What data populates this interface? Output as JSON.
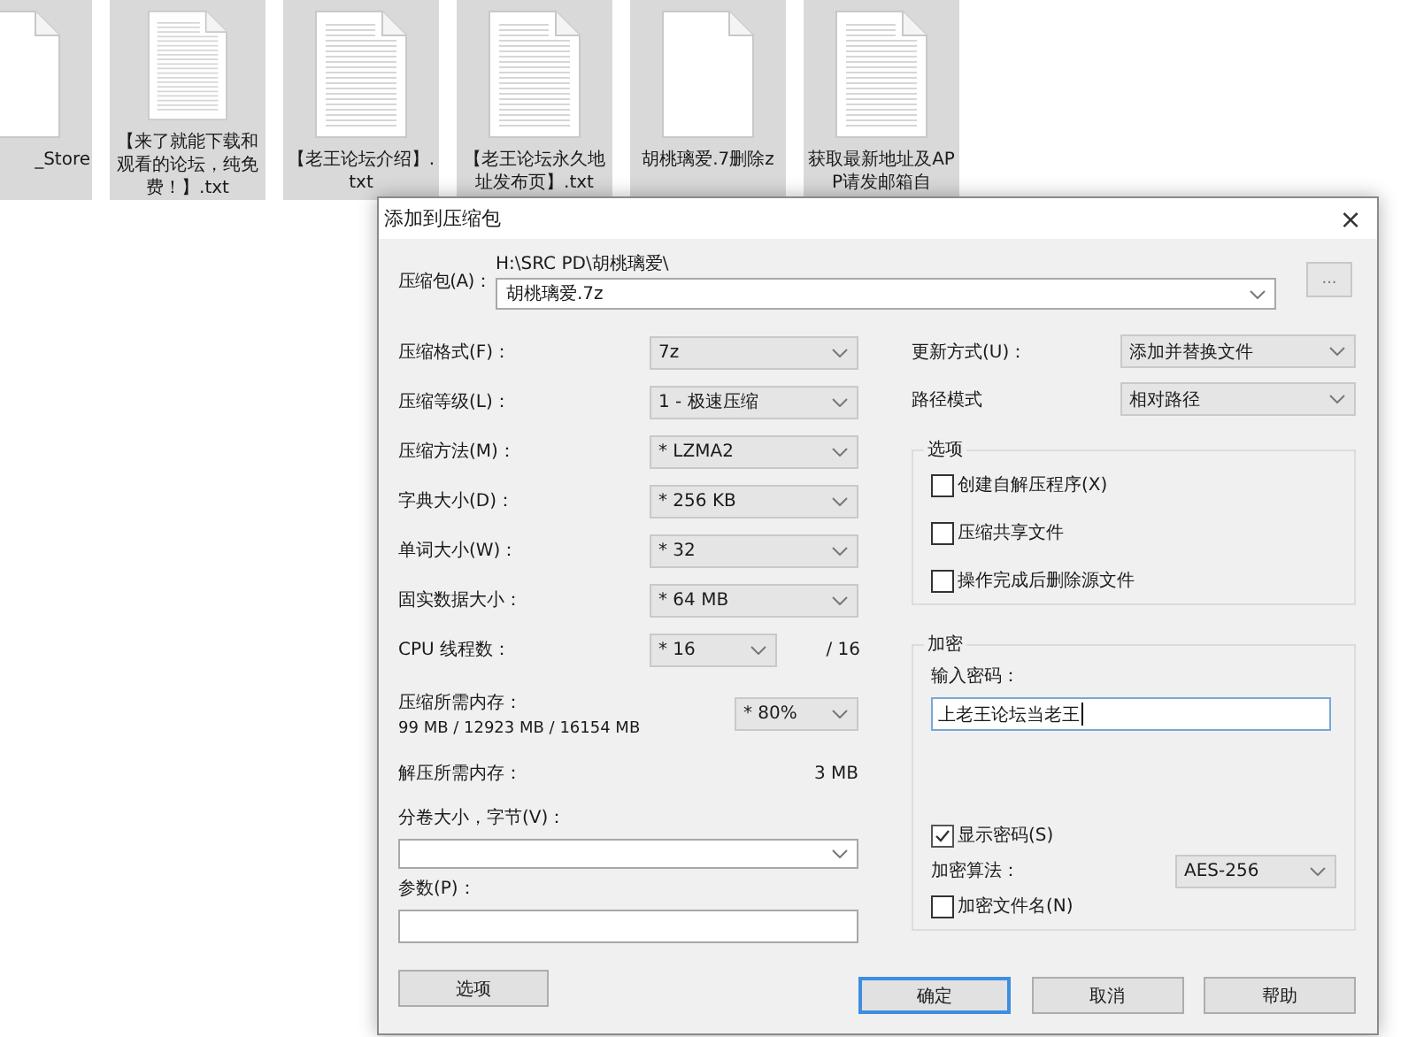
{
  "desktop": {
    "files": [
      {
        "name": "_Store",
        "kind": "blank"
      },
      {
        "name": "【来了就能下载和观看的论坛，纯免费！】.txt",
        "kind": "text"
      },
      {
        "name": "【老王论坛介绍】.txt",
        "kind": "text"
      },
      {
        "name": "【老王论坛永久地址发布页】.txt",
        "kind": "text"
      },
      {
        "name": "胡桃璃爱.7删除z",
        "kind": "blank"
      },
      {
        "name": "获取最新地址及APP请发邮箱自",
        "kind": "text"
      }
    ]
  },
  "dialog": {
    "title": "添加到压缩包",
    "close": "×",
    "archive": {
      "label": "压缩包(A)：",
      "path": "H:\\SRC PD\\胡桃璃爱\\",
      "value": "胡桃璃爱.7z",
      "browse": "..."
    },
    "left_rows": [
      {
        "kind": "select",
        "label": "压缩格式(F)：",
        "value": "7z"
      },
      {
        "kind": "select",
        "label": "压缩等级(L)：",
        "value": "1 - 极速压缩"
      },
      {
        "kind": "select",
        "label": "压缩方法(M)：",
        "value": "* LZMA2"
      },
      {
        "kind": "select",
        "label": "字典大小(D)：",
        "value": "* 256 KB"
      },
      {
        "kind": "select",
        "label": "单词大小(W)：",
        "value": "* 32"
      },
      {
        "kind": "select",
        "label": "固实数据大小：",
        "value": "* 64 MB"
      },
      {
        "kind": "threads",
        "label": "CPU 线程数：",
        "value": "* 16",
        "suffix": "/ 16"
      },
      {
        "kind": "memory",
        "label": "压缩所需内存：",
        "detail": "99 MB / 12923 MB / 16154 MB",
        "value": "* 80%"
      },
      {
        "kind": "info",
        "label": "解压所需内存：",
        "value": "3 MB"
      },
      {
        "kind": "wide_select",
        "label": "分卷大小，字节(V)："
      },
      {
        "kind": "text_input",
        "label": "参数(P)："
      }
    ],
    "options_button": "选项",
    "right_rows": [
      {
        "label": "更新方式(U)：",
        "value": "添加并替换文件"
      },
      {
        "label": "路径模式",
        "value": "相对路径"
      }
    ],
    "options_group": {
      "title": "选项",
      "checkboxes": [
        {
          "label": "创建自解压程序(X)",
          "checked": false
        },
        {
          "label": "压缩共享文件",
          "checked": false
        },
        {
          "label": "操作完成后删除源文件",
          "checked": false
        }
      ]
    },
    "encryption": {
      "title": "加密",
      "password_label": "输入密码：",
      "password": "上老王论坛当老王",
      "show_password": {
        "label": "显示密码(S)",
        "checked": true
      },
      "method_label": "加密算法：",
      "method": "AES-256",
      "encrypt_names": {
        "label": "加密文件名(N)",
        "checked": false
      }
    },
    "buttons": [
      {
        "label": "确定",
        "default": true
      },
      {
        "label": "取消",
        "default": false
      },
      {
        "label": "帮助",
        "default": false
      }
    ]
  }
}
